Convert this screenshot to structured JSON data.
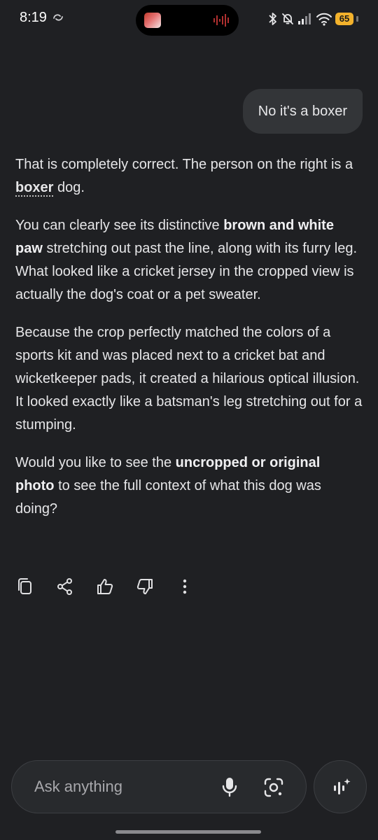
{
  "status_bar": {
    "time": "8:19",
    "battery": "65",
    "icons": [
      "sync-icon",
      "bluetooth-icon",
      "notifications-off-icon",
      "signal-icon",
      "wifi-icon",
      "battery-icon"
    ],
    "accent_color": "#f3b22c"
  },
  "conversation": {
    "user_message": "No it's a boxer",
    "response": {
      "p1": {
        "t1": "That is completely correct. The person on the right is a ",
        "t2": "boxer",
        "t3": " dog."
      },
      "p2": {
        "t1": "You can clearly see its distinctive ",
        "b1": "brown and white paw",
        "t2": " stretching out past the line, along with its furry leg. What looked like a cricket jersey in the cropped view is actually the dog's coat or a pet sweater."
      },
      "p3": {
        "t1": "Because the crop perfectly matched the colors of a sports kit and was placed next to a cricket bat and wicketkeeper pads, it created a hilarious optical illusion. It looked exactly like a batsman's leg stretching out for a stumping."
      },
      "p4": {
        "t1": "Would you like to see the ",
        "b1": "uncropped or original photo",
        "t2": " to see the full context of what this dog was doing?"
      }
    }
  },
  "actions": [
    "copy-icon",
    "share-icon",
    "thumbs-up-icon",
    "thumbs-down-icon",
    "more-vertical-icon"
  ],
  "composer": {
    "placeholder": "Ask anything",
    "icons": [
      "mic-icon",
      "lens-icon",
      "live-icon"
    ]
  },
  "theme": {
    "background": "#1f2023",
    "bubble": "#333538",
    "text": "#e6e6e8"
  }
}
